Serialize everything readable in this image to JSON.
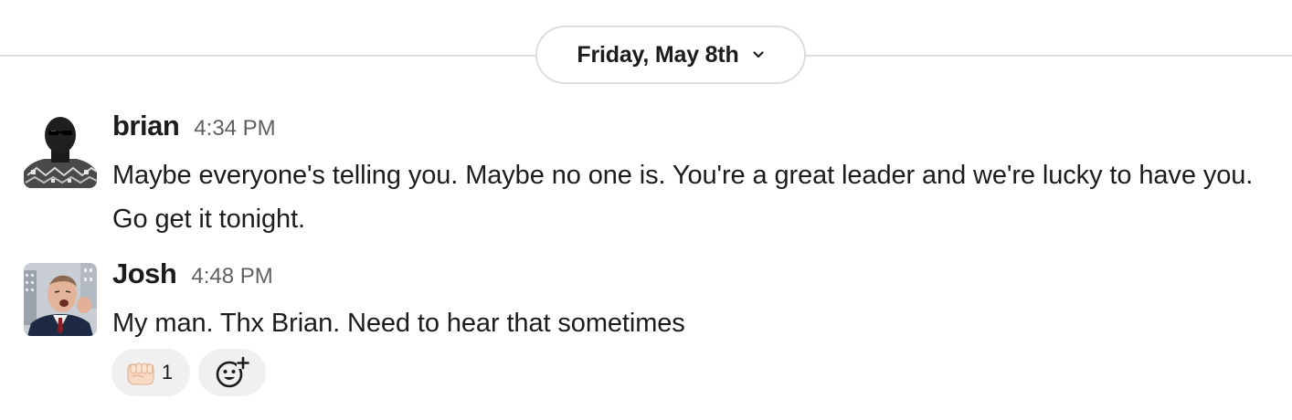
{
  "date_divider": {
    "label": "Friday, May 8th",
    "icon": "chevron-down-icon"
  },
  "messages": [
    {
      "author": "brian",
      "time": "4:34 PM",
      "text": "Maybe everyone's telling you. Maybe no one is. You're a great leader and we're lucky to have you. Go get it tonight.",
      "avatar_icon": "user-avatar"
    },
    {
      "author": "Josh",
      "time": "4:48 PM",
      "text": "My man. Thx Brian. Need to hear that sometimes",
      "avatar_icon": "user-avatar",
      "reactions": [
        {
          "emoji": "fist-bump-emoji",
          "count": "1"
        }
      ],
      "add_reaction_icon": "add-reaction-icon"
    }
  ],
  "colors": {
    "text": "#1d1c1d",
    "muted": "#616061",
    "divider": "#dddddd",
    "reaction_bg": "#f0f0f0"
  }
}
